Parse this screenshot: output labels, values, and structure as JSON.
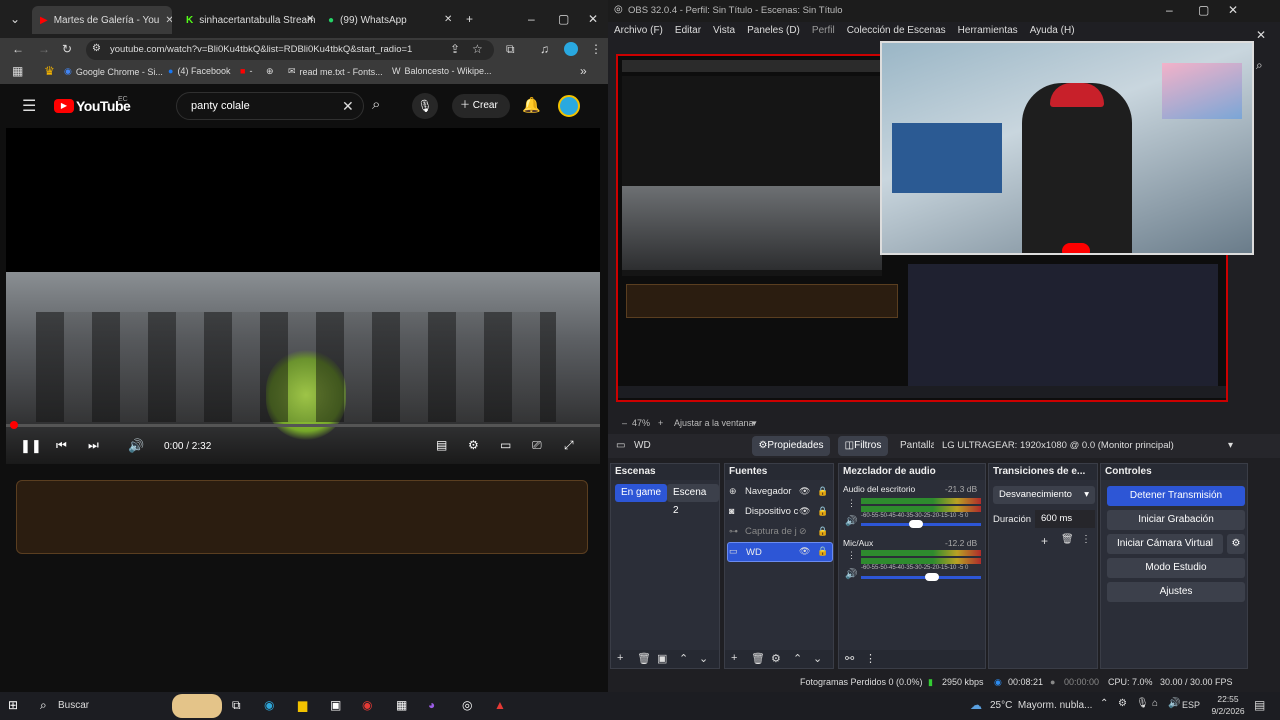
{
  "chrome": {
    "tabs": [
      {
        "label": "Martes de Galería - You",
        "active": true
      },
      {
        "label": "sinhacertantabulla Stream",
        "active": false
      },
      {
        "label": "(99) WhatsApp",
        "active": false
      }
    ],
    "url": "youtube.com/watch?v=Bli0Ku4tbkQ&list=RDBli0Ku4tbkQ&start_radio=1",
    "bookmarks": [
      "Google Chrome - Si...",
      "(4) Facebook",
      "-",
      "read me.txt - Fonts...",
      "Baloncesto - Wikipe..."
    ],
    "youtube": {
      "logo": "YouTube",
      "country": "EC",
      "search_value": "panty colale",
      "create_label": "Crear",
      "time": "0:00 / 2:32"
    }
  },
  "obs": {
    "title": "OBS 32.0.4 - Perfil: Sin Título - Escenas: Sin Título",
    "menu": [
      "Archivo (F)",
      "Editar",
      "Vista",
      "Paneles (D)",
      "Perfil",
      "Colección de Escenas",
      "Herramientas",
      "Ayuda (H)"
    ],
    "zoom": "47%",
    "fit_label": "Ajustar a la ventana",
    "source_name": "WD",
    "properties_label": "Propiedades",
    "filters_label": "Filtros",
    "screen_label": "Pantalla",
    "monitor": "LG ULTRAGEAR: 1920x1080 @ 0.0 (Monitor principal)",
    "docks": {
      "scenes_title": "Escenas",
      "scenes": [
        "En game",
        "Escena 2"
      ],
      "sources_title": "Fuentes",
      "sources": [
        "Navegador",
        "Dispositivo c",
        "Captura de j",
        "WD"
      ],
      "mixer_title": "Mezclador de audio",
      "mixer": [
        {
          "name": "Audio del escritorio",
          "db": "-21.3 dB",
          "level": 0.64
        },
        {
          "name": "Mic/Aux",
          "db": "-12.2 dB",
          "level": 0.76
        }
      ],
      "scale": "-60-55-50-45-40-35-30-25-20-15-10 -5 0",
      "transitions_title": "Transiciones de e...",
      "transition": "Desvanecimiento",
      "duration_label": "Duración",
      "duration": "600 ms",
      "controls_title": "Controles",
      "controls": [
        "Detener Transmisión",
        "Iniciar Grabación",
        "Iniciar Cámara Virtual",
        "Modo Estudio",
        "Ajustes"
      ]
    },
    "status": {
      "dropped": "Fotogramas Perdidos 0 (0.0%)",
      "bitrate": "2950 kbps",
      "stream_time": "00:08:21",
      "rec_time": "00:00:00",
      "cpu": "CPU: 7.0%",
      "fps": "30.00 / 30.00 FPS"
    }
  },
  "taskbar": {
    "search": "Buscar",
    "weather": "25°C  Mayorm. nubla...",
    "lang": "ESP",
    "time": "22:55",
    "date": "9/2/2026"
  },
  "colors": {
    "accent": "#2d56d6",
    "record": "#cc0000",
    "youtube": "#ff0000"
  }
}
